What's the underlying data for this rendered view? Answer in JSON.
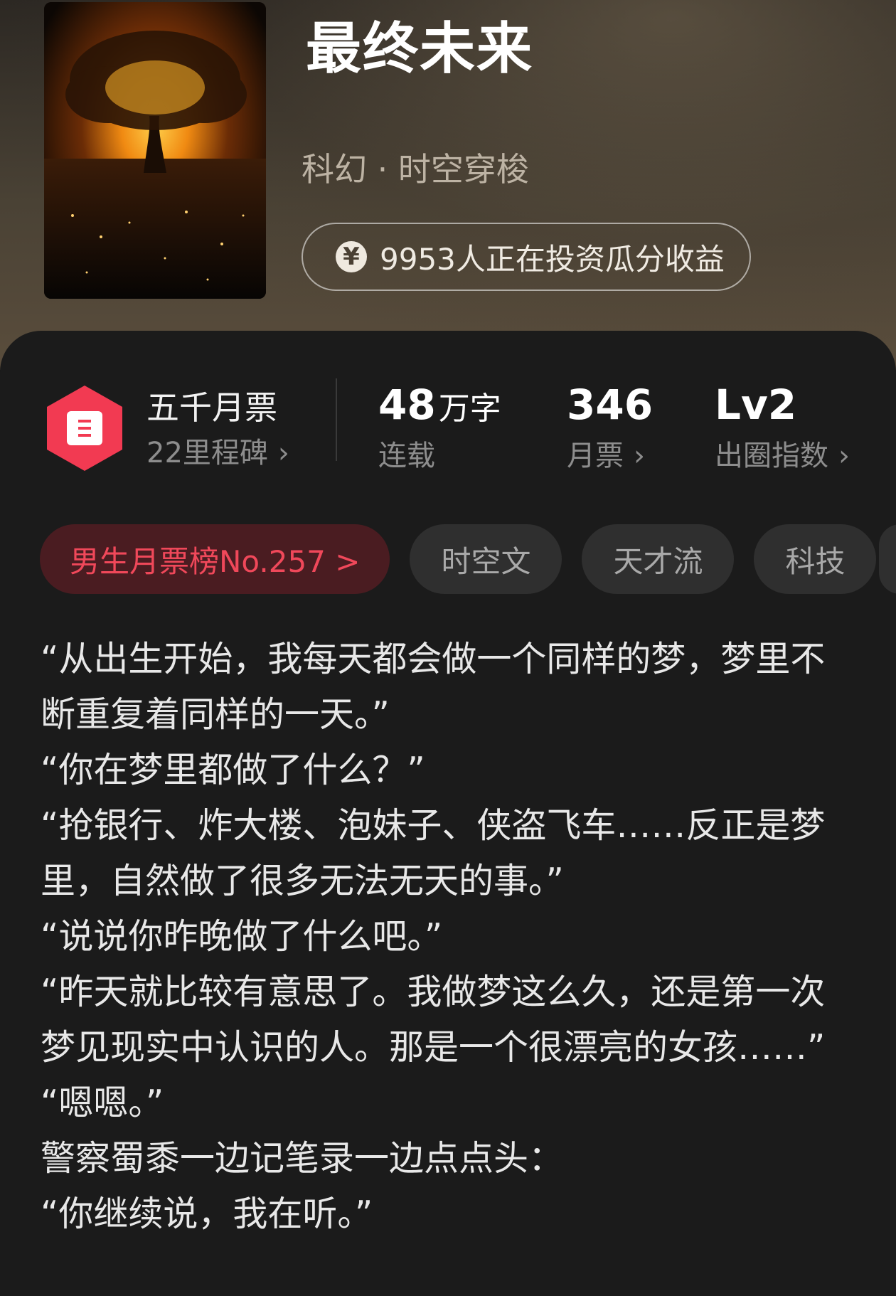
{
  "book": {
    "title": "最终未来",
    "genre": "科幻 · 时空穿梭",
    "invest_icon": "yen-icon",
    "invest_text": "9953人正在投资瓜分收益"
  },
  "stats": {
    "ticket_badge_icon": "ticket-badge-icon",
    "milestone_title": "五千月票",
    "milestone_sub": "22里程碑",
    "word_count_number": "48",
    "word_count_unit": "万字",
    "word_count_label": "连载",
    "monthly_tickets_value": "346",
    "monthly_tickets_label": "月票",
    "breakout_value": "Lv2",
    "breakout_label": "出圈指数",
    "chevron": "›"
  },
  "tags": {
    "rank": "男生月票榜No.257 >",
    "items": [
      "时空文",
      "天才流",
      "科技"
    ]
  },
  "intro": [
    "“从出生开始，我每天都会做一个同样的梦，梦里不断重复着同样的一天。”",
    "“你在梦里都做了什么？”",
    "“抢银行、炸大楼、泡妹子、侠盗飞车……反正是梦里，自然做了很多无法无天的事。”",
    "“说说你昨晚做了什么吧。”",
    "“昨天就比较有意思了。我做梦这么久，还是第一次梦见现实中认识的人。那是一个很漂亮的女孩……”",
    "“嗯嗯。”",
    "警察蜀黍一边记笔录一边点点头：",
    "“你继续说，我在听。”"
  ],
  "colors": {
    "rank_text": "#f0485a",
    "rank_bg": "#4a1c21",
    "badge": "#f23a52"
  }
}
